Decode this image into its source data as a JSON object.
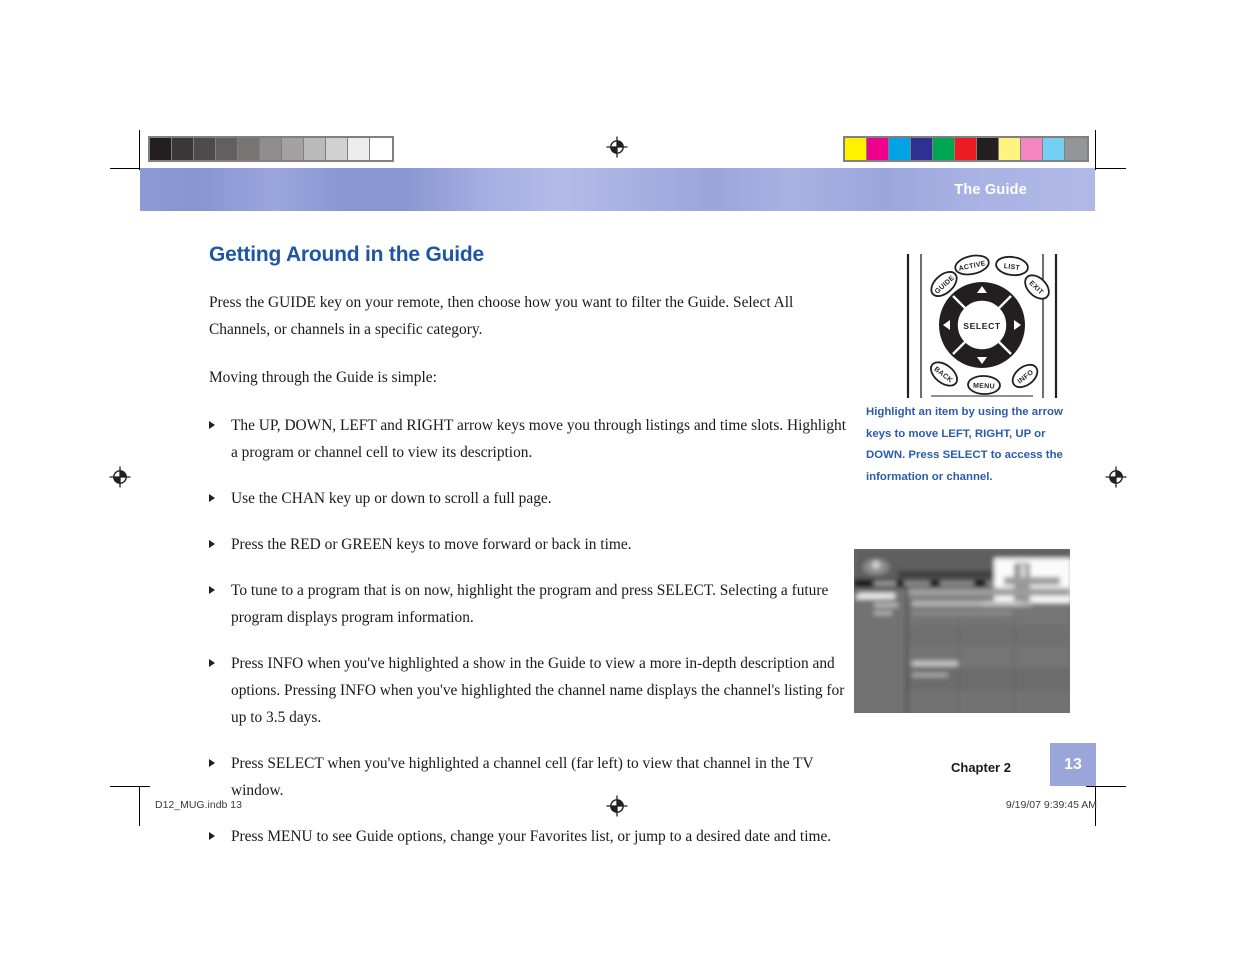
{
  "banner": {
    "running_head": "The Guide",
    "gradient_start": "#8d9bd4",
    "gradient_end": "#b0b9e6"
  },
  "content": {
    "heading": "Getting Around in the Guide",
    "heading_color": "#1f55a5",
    "paragraphs": [
      "Press the GUIDE key on your remote, then choose how you want to filter the Guide. Select All Channels, or channels in a specific category.",
      "Moving through the Guide is simple:"
    ],
    "bullets": [
      "The UP, DOWN, LEFT and RIGHT arrow keys move you through listings and time slots. Highlight a program or channel cell to view its description.",
      "Use the CHAN key up or down to scroll a full page.",
      "Press the RED or GREEN keys to move forward or back in time.",
      "To tune to a program that is on now, highlight the program and press SELECT. Selecting a future program displays program information.",
      "Press INFO when you've highlighted a show in the Guide to view a more in-depth description and options. Pressing INFO when you've highlighted the channel name displays the channel's listing for up to 3.5 days.",
      "Press SELECT when you've highlighted a channel cell (far left) to view that channel in the TV window.",
      "Press MENU to see Guide options, change your Favorites list, or jump to a desired date and time."
    ]
  },
  "remote": {
    "buttons": {
      "guide": "GUIDE",
      "active": "ACTIVE",
      "list": "LIST",
      "exit": "EXIT",
      "select": "SELECT",
      "back": "BACK",
      "menu": "MENU",
      "info": "INFO"
    },
    "caption": "Highlight an item by using the arrow keys to move LEFT, RIGHT, UP or DOWN. Press SELECT to access the information or channel."
  },
  "folio": {
    "chapter": "Chapter 2",
    "page_number": "13",
    "page_box_color": "#9aa5d9"
  },
  "slug": {
    "left": "D12_MUG.indb   13",
    "right": "9/19/07   9:39:45 AM"
  },
  "calibration": {
    "grayscale": [
      "#231f20",
      "#3b3738",
      "#4f4b4c",
      "#625f60",
      "#777474",
      "#8f8d8d",
      "#a3a1a1",
      "#bbbaba",
      "#d2d1d1",
      "#ececec",
      "#ffffff"
    ],
    "colors": [
      "#fff200",
      "#ec008c",
      "#00a3e4",
      "#2e3192",
      "#00a551",
      "#ed1c24",
      "#231f20",
      "#fff47f",
      "#f386c0",
      "#76cff0",
      "#939598"
    ]
  }
}
